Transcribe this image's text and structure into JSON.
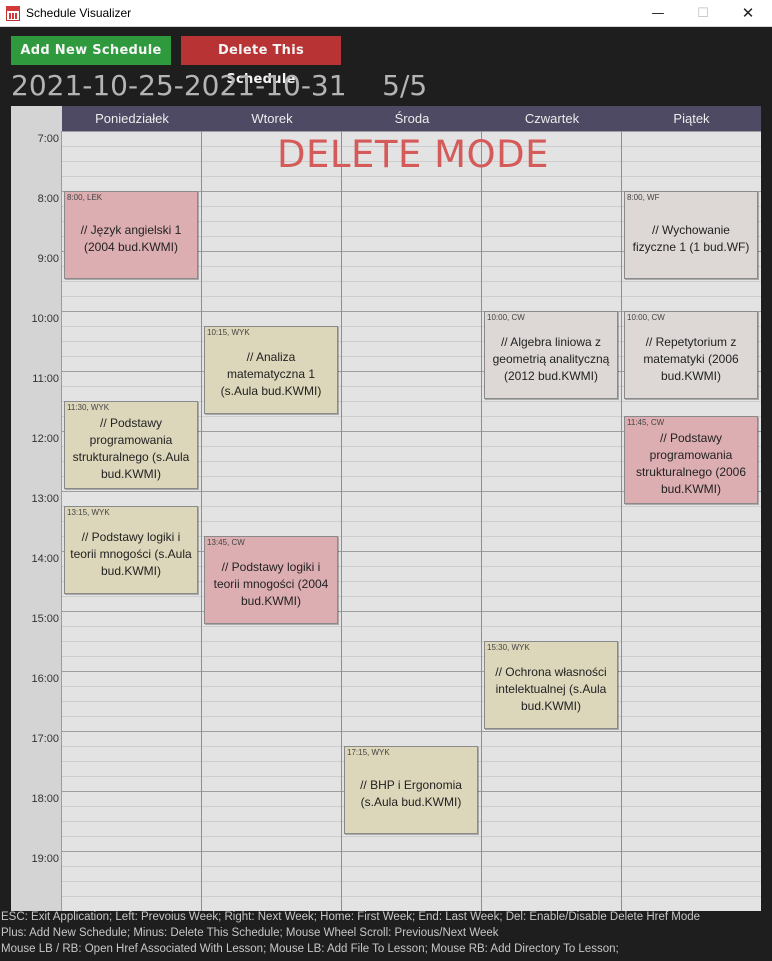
{
  "window": {
    "title": "Schedule Visualizer",
    "minimize_glyph": "—",
    "maximize_glyph": "☐",
    "close_glyph": "✕"
  },
  "toolbar": {
    "add_label": "Add New Schedule",
    "delete_label": "Delete This Schedule"
  },
  "header": {
    "range_text": "2021-10-25-2021-10-31    5/5"
  },
  "calendar": {
    "days": [
      "Poniedziałek",
      "Wtorek",
      "Środa",
      "Czwartek",
      "Piątek"
    ],
    "hours": [
      "7:00",
      "8:00",
      "9:00",
      "10:00",
      "11:00",
      "12:00",
      "13:00",
      "14:00",
      "15:00",
      "16:00",
      "17:00",
      "18:00",
      "19:00"
    ],
    "mode_overlay": "DELETE MODE"
  },
  "lessons": [
    {
      "tag": "8:00, LEK",
      "name": "// Język angielski 1 (2004 bud.KWMI)",
      "kind": "lek"
    },
    {
      "tag": "11:30, WYK",
      "name": "// Podstawy programowania strukturalnego (s.Aula bud.KWMI)",
      "kind": "wyk"
    },
    {
      "tag": "13:15, WYK",
      "name": "// Podstawy logiki i teorii mnogości (s.Aula bud.KWMI)",
      "kind": "wyk"
    },
    {
      "tag": "10:15, WYK",
      "name": "// Analiza matematyczna 1 (s.Aula bud.KWMI)",
      "kind": "wyk"
    },
    {
      "tag": "13:45, CW",
      "name": "// Podstawy logiki i teorii mnogości (2004 bud.KWMI)",
      "kind": "cw-red"
    },
    {
      "tag": "17:15, WYK",
      "name": "// BHP i Ergonomia (s.Aula bud.KWMI)",
      "kind": "wyk"
    },
    {
      "tag": "10:00, CW",
      "name": "// Algebra liniowa z geometrią analityczną (2012 bud.KWMI)",
      "kind": "cw-gray"
    },
    {
      "tag": "15:30, WYK",
      "name": "// Ochrona własności intelektualnej (s.Aula bud.KWMI)",
      "kind": "wyk"
    },
    {
      "tag": "8:00, WF",
      "name": "// Wychowanie fizyczne 1 (1 bud.WF)",
      "kind": "wf"
    },
    {
      "tag": "10:00, CW",
      "name": "// Repetytorium z matematyki (2006 bud.KWMI)",
      "kind": "cw-gray"
    },
    {
      "tag": "11:45, CW",
      "name": "// Podstawy programowania strukturalnego (2006 bud.KWMI)",
      "kind": "cw-red"
    }
  ],
  "help": {
    "line1": "ESC: Exit Application;   Left: Prevoius Week;   Right: Next Week;   Home: First Week;   End: Last Week;   Del: Enable/Disable Delete Href Mode",
    "line2": "Plus: Add New Schedule;   Minus: Delete This Schedule;   Mouse Wheel Scroll: Previous/Next Week",
    "line3": "Mouse LB / RB: Open Href Associated With Lesson;    Mouse LB: Add File To Lesson;    Mouse RB: Add Directory To Lesson;"
  }
}
